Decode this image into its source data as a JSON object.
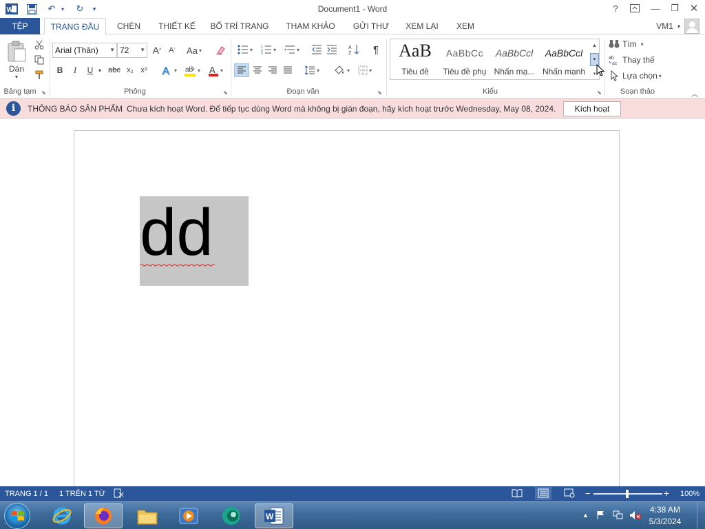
{
  "window": {
    "title": "Document1 - Word",
    "help": "?",
    "user": "VM1"
  },
  "tabs": [
    "TỆP",
    "TRANG ĐẦU",
    "CHÈN",
    "THIẾT KẾ",
    "BỐ TRÍ TRANG",
    "THAM KHẢO",
    "GỬI THƯ",
    "XEM LẠI",
    "XEM"
  ],
  "ribbon": {
    "clipboard": {
      "paste_label": "Dán",
      "group_label": "Bảng tạm"
    },
    "font": {
      "font_name": "Arial (Thân)",
      "font_size": "72",
      "grow": "A",
      "shrink": "A",
      "case": "Aa",
      "bold": "B",
      "italic": "I",
      "underline": "U",
      "strike": "abc",
      "subscript": "x₂",
      "superscript": "x²",
      "group_label": "Phông"
    },
    "paragraph": {
      "pilcrow": "¶",
      "group_label": "Đoạn văn"
    },
    "styles": {
      "items": [
        {
          "preview": "AaB",
          "name": "Tiêu đề"
        },
        {
          "preview": "AaBbCc",
          "name": "Tiêu đề phụ"
        },
        {
          "preview": "AaBbCcl",
          "name": "Nhấn mạ..."
        },
        {
          "preview": "AaBbCcl",
          "name": "Nhấn mạnh"
        }
      ],
      "group_label": "Kiểu"
    },
    "editing": {
      "find": "Tìm",
      "replace": "Thay thế",
      "select": "Lựa chọn",
      "group_label": "Soạn thảo"
    }
  },
  "notification": {
    "title": "THÔNG BÁO SẢN PHẨM",
    "message": "Chưa kích hoạt Word. Để tiếp tục dùng Word mà không bị gián đoạn, hãy kích hoạt trước Wednesday, May 08, 2024.",
    "button": "Kích hoạt"
  },
  "document": {
    "text": "dd"
  },
  "statusbar": {
    "page": "TRANG 1 / 1",
    "words": "1 TRÊN 1 TỪ",
    "zoom": "100%"
  },
  "zoom_level": 100,
  "taskbar": {
    "time": "4:38 AM",
    "date": "5/3/2024"
  },
  "colors": {
    "accent": "#2b579a",
    "notification_bg": "#f9dcdc",
    "selection": "#c6c6c6",
    "font_color": "#e0211d",
    "highlight": "#ffe100"
  },
  "icons": [
    "word-logo-icon",
    "save-icon",
    "undo-icon",
    "redo-icon",
    "paste-icon",
    "cut-icon",
    "copy-icon",
    "format-painter-icon",
    "info-icon",
    "firefox-icon",
    "internet-explorer-icon",
    "file-explorer-icon",
    "media-player-icon",
    "word-taskbar-icon"
  ]
}
